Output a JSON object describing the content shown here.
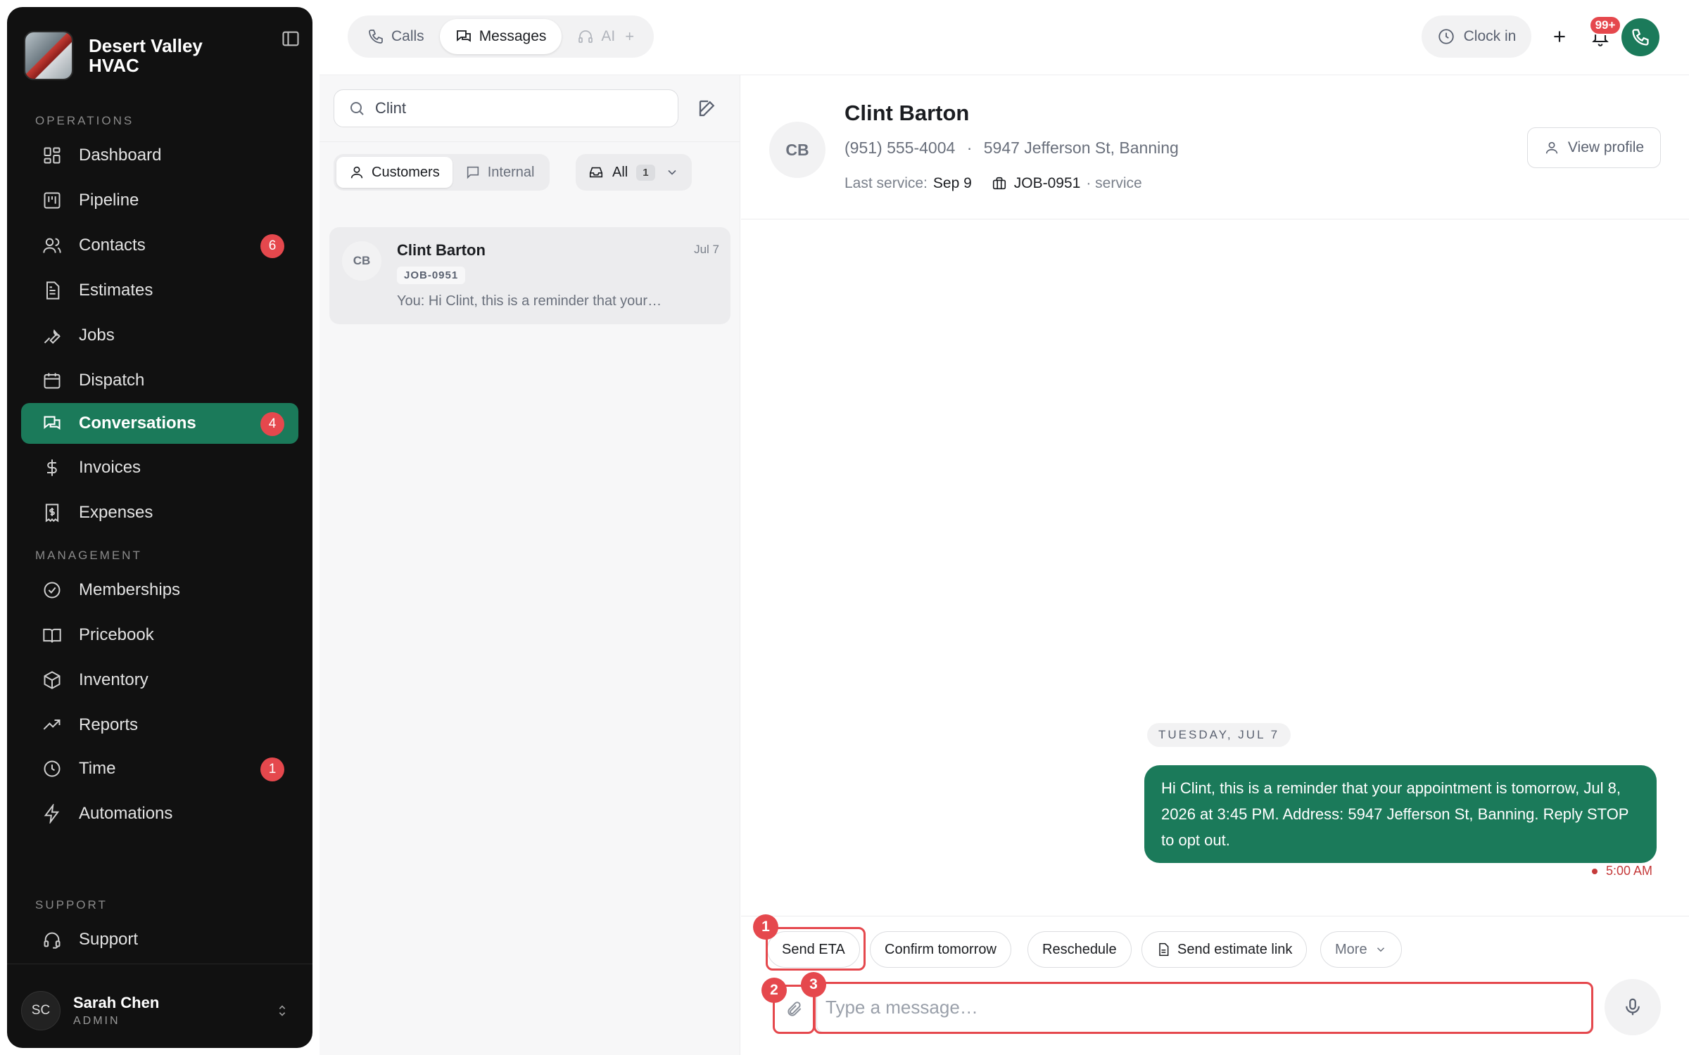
{
  "brand": {
    "name": "Desert Valley HVAC"
  },
  "sidebar": {
    "sections": {
      "operations": "OPERATIONS",
      "management": "MANAGEMENT",
      "support": "SUPPORT"
    },
    "items": [
      {
        "label": "Dashboard",
        "icon": "dashboard-icon"
      },
      {
        "label": "Pipeline",
        "icon": "pipeline-icon"
      },
      {
        "label": "Contacts",
        "icon": "contacts-icon",
        "badge": "6"
      },
      {
        "label": "Estimates",
        "icon": "estimates-icon"
      },
      {
        "label": "Jobs",
        "icon": "wrench-icon"
      },
      {
        "label": "Dispatch",
        "icon": "calendar-icon"
      },
      {
        "label": "Conversations",
        "icon": "chat-icon",
        "badge": "4",
        "active": true
      },
      {
        "label": "Invoices",
        "icon": "dollar-icon"
      },
      {
        "label": "Expenses",
        "icon": "receipt-icon"
      },
      {
        "label": "Memberships",
        "icon": "badge-check-icon"
      },
      {
        "label": "Pricebook",
        "icon": "book-icon"
      },
      {
        "label": "Inventory",
        "icon": "box-icon"
      },
      {
        "label": "Reports",
        "icon": "trending-icon"
      },
      {
        "label": "Time",
        "icon": "clock-icon",
        "badge": "1"
      },
      {
        "label": "Automations",
        "icon": "bolt-icon"
      },
      {
        "label": "Support",
        "icon": "headset-icon"
      }
    ],
    "user": {
      "initials": "SC",
      "name": "Sarah Chen",
      "role": "ADMIN"
    }
  },
  "topbar": {
    "tabs": [
      {
        "label": "Calls"
      },
      {
        "label": "Messages",
        "active": true
      },
      {
        "label": "AI"
      }
    ],
    "clock_in": "Clock in",
    "notifications_badge": "99+"
  },
  "list": {
    "search_value": "Clint",
    "segments": [
      {
        "label": "Customers",
        "active": true
      },
      {
        "label": "Internal"
      }
    ],
    "filter": {
      "label": "All",
      "count": "1"
    },
    "conversations": [
      {
        "initials": "CB",
        "name": "Clint Barton",
        "date": "Jul 7",
        "tag": "JOB-0951",
        "preview": "You: Hi Clint, this is a reminder that your…"
      }
    ]
  },
  "chat": {
    "contact": {
      "initials": "CB",
      "name": "Clint Barton",
      "phone": "(951) 555-4004",
      "separator": "·",
      "address": "5947 Jefferson St, Banning",
      "last_service_label": "Last service:",
      "last_service_value": "Sep 9",
      "job_id": "JOB-0951",
      "job_type": "· service"
    },
    "view_profile": "View profile",
    "date_divider": "TUESDAY, JUL 7",
    "messages": [
      {
        "text": "Hi Clint, this is a reminder that your appointment is tomorrow, Jul 8, 2026 at 3:45 PM. Address: 5947 Jefferson St, Banning. Reply STOP to opt out.",
        "time": "5:00 AM"
      }
    ],
    "quick_replies": [
      "Send ETA",
      "Confirm tomorrow",
      "Reschedule",
      "Send estimate link",
      "More"
    ],
    "input_placeholder": "Type a message…",
    "markers": [
      "1",
      "2",
      "3"
    ]
  }
}
